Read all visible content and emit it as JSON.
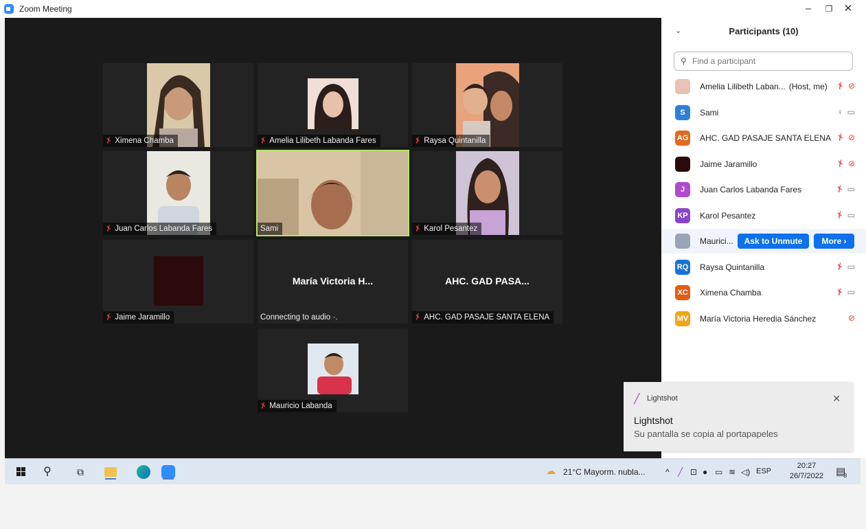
{
  "window": {
    "title": "Zoom Meeting",
    "minimize_icon": "minimize-icon",
    "restore_icon": "restore-icon",
    "close_icon": "close-icon"
  },
  "tiles": [
    {
      "name": "Ximena Chamba",
      "mic_muted": true,
      "photo_colors": [
        "#d9c9a8",
        "#3a2b22"
      ]
    },
    {
      "name": "Amelia Lilibeth Labanda Fares",
      "mic_muted": true,
      "photo_colors": [
        "#f0dfd6",
        "#2b1d1a"
      ]
    },
    {
      "name": "Raysa Quintanilla",
      "mic_muted": true,
      "photo_colors": [
        "#e8a27c",
        "#3b2a25"
      ]
    },
    {
      "name": "Juan Carlos Labanda Fares",
      "mic_muted": true,
      "photo_colors": [
        "#e9e9e2",
        "#2e2219"
      ]
    },
    {
      "name": "Sami",
      "mic_muted": false,
      "active_speaker": true,
      "photo_colors": [
        "#d9c4a6",
        "#2a1e18"
      ]
    },
    {
      "name": "Karol Pesantez",
      "mic_muted": true,
      "photo_colors": [
        "#cfc3d6",
        "#2f211c"
      ]
    },
    {
      "name": "Jaime Jaramillo",
      "mic_muted": true,
      "photo_colors": [
        "#2a0c0c",
        "#3a1010"
      ]
    },
    {
      "name": "Connecting to audio ·.",
      "center_name": "María Victoria H...",
      "mic_muted": false
    },
    {
      "name": "AHC. GAD PASAJE SANTA ELENA",
      "center_name": "AHC. GAD PASA...",
      "mic_muted": true
    },
    {
      "name": "Mauricio Labanda",
      "mic_muted": true,
      "photo_colors": [
        "#dfe8ee",
        "#d8334a"
      ]
    }
  ],
  "panel": {
    "title": "Participants (10)",
    "search_placeholder": "Find a participant",
    "participants": [
      {
        "name": "Amelia Lilibeth Laban...",
        "role": "(Host, me)",
        "initials": "",
        "avatar_color": "#e8c2b4",
        "mic": "off",
        "video": "off"
      },
      {
        "name": "Sami",
        "role": "",
        "initials": "S",
        "avatar_color": "#2d7fd8",
        "mic": "on",
        "video": "on"
      },
      {
        "name": "AHC. GAD PASAJE SANTA ELENA",
        "role": "",
        "initials": "AG",
        "avatar_color": "#e36a1e",
        "mic": "off",
        "video": "off"
      },
      {
        "name": "Jaime Jaramillo",
        "role": "",
        "initials": "",
        "avatar_color": "#2a0a0a",
        "mic": "off",
        "video": "off"
      },
      {
        "name": "Juan Carlos Labanda Fares",
        "role": "",
        "initials": "J",
        "avatar_color": "#b04bd0",
        "mic": "off",
        "video": "on"
      },
      {
        "name": "Karol Pesantez",
        "role": "",
        "initials": "KP",
        "avatar_color": "#8a44c8",
        "mic": "off",
        "video": "on"
      },
      {
        "name": "Maurici...",
        "role": "",
        "initials": "",
        "avatar_color": "#9aa4b8",
        "mic": "off",
        "video": "on",
        "hover": true,
        "ask_label": "Ask to Unmute",
        "more_label": "More"
      },
      {
        "name": "Raysa Quintanilla",
        "role": "",
        "initials": "RQ",
        "avatar_color": "#1a73d4",
        "mic": "off",
        "video": "on"
      },
      {
        "name": "Ximena Chamba",
        "role": "",
        "initials": "XC",
        "avatar_color": "#e35d12",
        "mic": "off",
        "video": "on"
      },
      {
        "name": "María Victoria Heredia Sánchez",
        "role": "",
        "initials": "MV",
        "avatar_color": "#f2a516",
        "mic": "none",
        "video": "off"
      }
    ]
  },
  "toast": {
    "app_name": "Lightshot",
    "title": "Lightshot",
    "body": "Su pantalla se copia al portapapeles"
  },
  "taskbar": {
    "weather": "21°C  Mayorm. nubla...",
    "language": "ESP",
    "time": "20:27",
    "date": "26/7/2022",
    "notification_count": "3"
  }
}
